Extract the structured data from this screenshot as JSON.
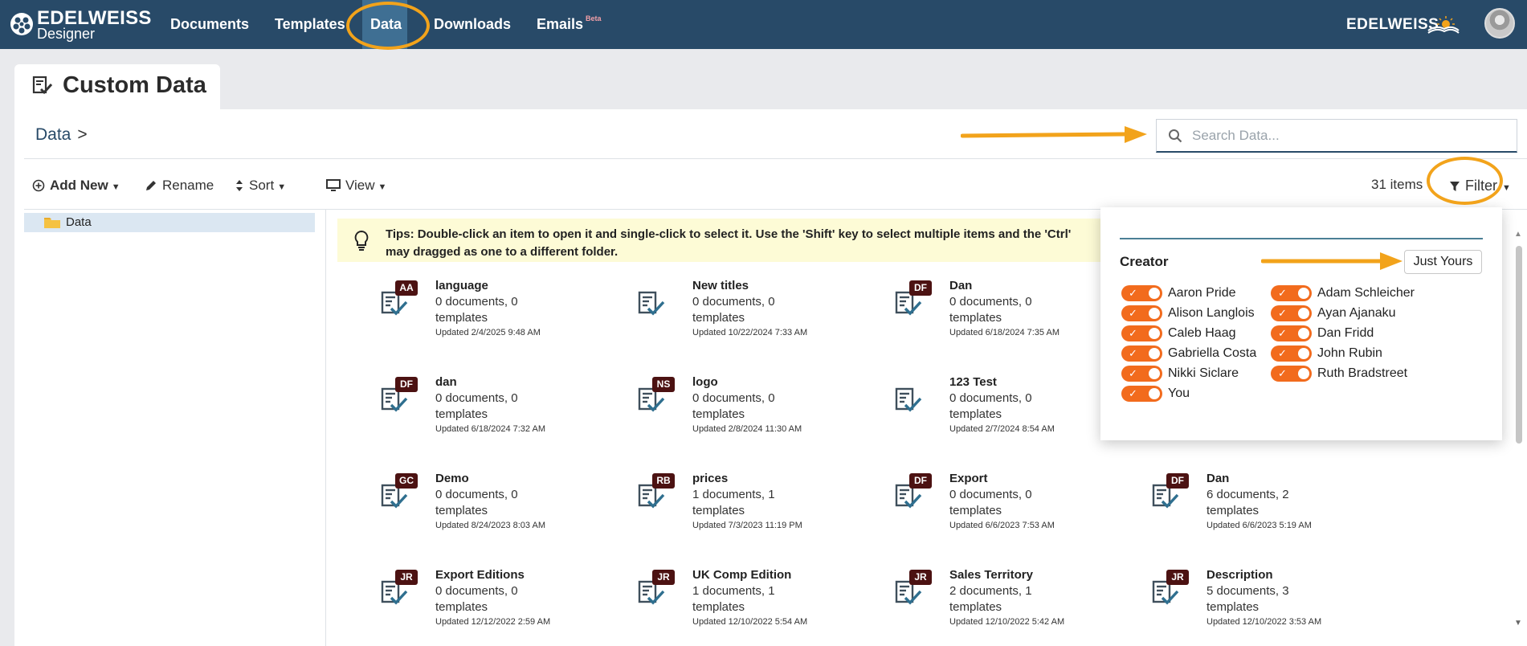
{
  "nav": {
    "logo_name": "EDELWEISS",
    "logo_sub": "Designer",
    "items": [
      "Documents",
      "Templates",
      "Data",
      "Downloads",
      "Emails"
    ],
    "beta": "Beta",
    "brand_right": "EDELWEISS"
  },
  "page": {
    "title": "Custom Data"
  },
  "breadcrumb": {
    "root": "Data",
    "sep": ">"
  },
  "search": {
    "placeholder": "Search Data..."
  },
  "toolbar": {
    "add_new": "Add New",
    "rename": "Rename",
    "sort": "Sort",
    "view": "View",
    "items_count": "31 items",
    "filter": "Filter"
  },
  "tree": {
    "root": "Data"
  },
  "tips": {
    "line1": "Tips: Double-click an item to open it and single-click to select it. Use the 'Shift' key to select multiple items and the 'Ctrl'",
    "line2": "may dragged as one to a different folder."
  },
  "cards": [
    {
      "badge": "AA",
      "name": "language",
      "docs": "0 documents, 0 templates",
      "updated": "Updated 2/4/2025 9:48 AM"
    },
    {
      "badge": "",
      "name": "New titles",
      "docs": "0 documents, 0 templates",
      "updated": "Updated 10/22/2024 7:33 AM"
    },
    {
      "badge": "DF",
      "name": "Dan",
      "docs": "0 documents, 0 templates",
      "updated": "Updated 6/18/2024 7:35 AM"
    },
    {
      "badge": "DF",
      "name": "dan",
      "docs": "0 documents, 0 templates",
      "updated": "Updated 6/18/2024 7:32 AM"
    },
    {
      "badge": "NS",
      "name": "logo",
      "docs": "0 documents, 0 templates",
      "updated": "Updated 2/8/2024 11:30 AM"
    },
    {
      "badge": "",
      "name": "123 Test",
      "docs": "0 documents, 0 templates",
      "updated": "Updated 2/7/2024 8:54 AM"
    },
    {
      "badge": "GC",
      "name": "Demo",
      "docs": "0 documents, 0 templates",
      "updated": "Updated 8/24/2023 8:03 AM"
    },
    {
      "badge": "RB",
      "name": "prices",
      "docs": "1 documents, 1 templates",
      "updated": "Updated 7/3/2023 11:19 PM"
    },
    {
      "badge": "DF",
      "name": "Export",
      "docs": "0 documents, 0 templates",
      "updated": "Updated 6/6/2023 7:53 AM"
    },
    {
      "badge": "DF",
      "name": "Dan",
      "docs": "6 documents, 2 templates",
      "updated": "Updated 6/6/2023 5:19 AM"
    },
    {
      "badge": "JR",
      "name": "Export Editions",
      "docs": "0 documents, 0 templates",
      "updated": "Updated 12/12/2022 2:59 AM"
    },
    {
      "badge": "JR",
      "name": "UK Comp Edition",
      "docs": "1 documents, 1 templates",
      "updated": "Updated 12/10/2022 5:54 AM"
    },
    {
      "badge": "JR",
      "name": "Sales Territory",
      "docs": "2 documents, 1 templates",
      "updated": "Updated 12/10/2022 5:42 AM"
    },
    {
      "badge": "JR",
      "name": "Description",
      "docs": "5 documents, 3 templates",
      "updated": "Updated 12/10/2022 3:53 AM"
    }
  ],
  "filter_panel": {
    "title": "Creator",
    "just_yours": "Just Yours",
    "creators": [
      "Aaron Pride",
      "Adam Schleicher",
      "Alison Langlois",
      "Ayan Ajanaku",
      "Caleb Haag",
      "Dan Fridd",
      "Gabriella Costa",
      "John Rubin",
      "Nikki Siclare",
      "Ruth Bradstreet",
      "You"
    ],
    "toggle_color": "#f26b1d"
  },
  "colors": {
    "nav_bg": "#284a68",
    "accent_ring": "#f2a31b",
    "badge_bg": "#4c1212",
    "tips_bg": "#fdfbd6"
  }
}
